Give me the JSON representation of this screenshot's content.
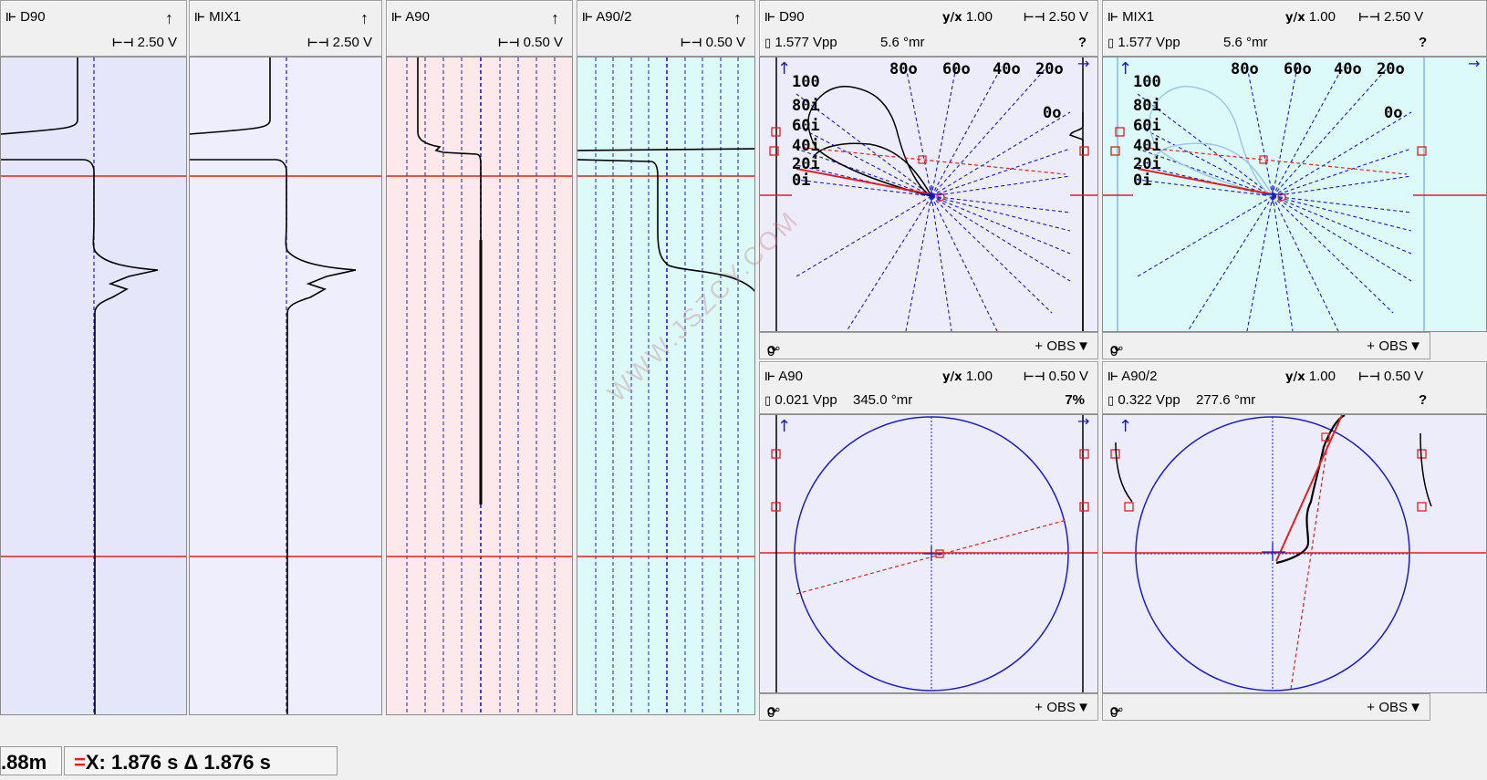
{
  "strips": [
    {
      "name": "D90",
      "range": "2.50 V",
      "marker": "↑"
    },
    {
      "name": "MIX1",
      "range": "2.50 V",
      "marker": "↑"
    },
    {
      "name": "A90",
      "range": "0.50 V",
      "marker": "↑"
    },
    {
      "name": "A90/2",
      "range": "0.50 V",
      "marker": "↑"
    }
  ],
  "lissajous": [
    {
      "name": "D90",
      "ratio": "1.00",
      "range": "2.50 V",
      "vpp": "1.577 Vpp",
      "angle": "5.6 °mr",
      "status": "?",
      "rotation": "0°",
      "obs": "OBS"
    },
    {
      "name": "MIX1",
      "ratio": "1.00",
      "range": "2.50 V",
      "vpp": "1.577 Vpp",
      "angle": "5.6 °mr",
      "status": "?",
      "rotation": "0°",
      "obs": "OBS"
    },
    {
      "name": "A90",
      "ratio": "1.00",
      "range": "0.50 V",
      "vpp": "0.021 Vpp",
      "angle": "345.0 °mr",
      "status": "7%",
      "rotation": "0°",
      "obs": "OBS"
    },
    {
      "name": "A90/2",
      "ratio": "1.00",
      "range": "0.50 V",
      "vpp": "0.322 Vpp",
      "angle": "277.6 °mr",
      "status": "?",
      "rotation": "0°",
      "obs": "OBS"
    }
  ],
  "calibration_labels": {
    "top": [
      "80o",
      "60o",
      "40o",
      "20o"
    ],
    "right": "0o",
    "left": [
      "100",
      "80i",
      "60i",
      "40i",
      "20i",
      "0i"
    ]
  },
  "status_bar": {
    "position": ".88m",
    "marker": "=",
    "time": "X: 1.876 s Δ 1.876 s"
  },
  "watermark": "WWW.JSZCY.COM",
  "icons": {
    "ratio": "y/x",
    "range": "range-icon",
    "signal": "signal-icon",
    "probe": "probe-icon",
    "rotate": "rotate-icon",
    "plus": "+",
    "dropdown": "▼"
  },
  "colors": {
    "strip1_bg": "#e6e6fa",
    "strip2_bg": "#eeeefc",
    "strip3_bg": "#fde9ec",
    "strip4_bg": "#dcfafa",
    "red": "#e02020",
    "blue": "#1a1acd",
    "header_bg": "#f0f0f0"
  }
}
